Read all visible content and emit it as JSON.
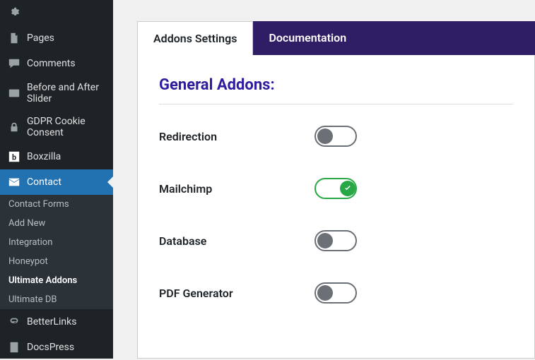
{
  "sidebar": {
    "items": [
      {
        "label": "",
        "icon": "gear"
      },
      {
        "label": "Pages",
        "icon": "page"
      },
      {
        "label": "Comments",
        "icon": "comment"
      },
      {
        "label": "Before and After Slider",
        "icon": "slider"
      },
      {
        "label": "GDPR Cookie Consent",
        "icon": "lock"
      },
      {
        "label": "Boxzilla",
        "icon": "box-b"
      },
      {
        "label": "Contact",
        "icon": "mail",
        "active": true
      },
      {
        "label": "BetterLinks",
        "icon": "link"
      },
      {
        "label": "DocsPress",
        "icon": "docs"
      }
    ],
    "submenu": [
      {
        "label": "Contact Forms"
      },
      {
        "label": "Add New"
      },
      {
        "label": "Integration"
      },
      {
        "label": "Honeypot"
      },
      {
        "label": "Ultimate Addons",
        "current": true
      },
      {
        "label": "Ultimate DB"
      }
    ]
  },
  "tabs": {
    "active": "Addons Settings",
    "inactive": "Documentation"
  },
  "section": {
    "title": "General Addons:"
  },
  "addons": [
    {
      "label": "Redirection",
      "on": false
    },
    {
      "label": "Mailchimp",
      "on": true
    },
    {
      "label": "Database",
      "on": false
    },
    {
      "label": "PDF Generator",
      "on": false
    }
  ]
}
